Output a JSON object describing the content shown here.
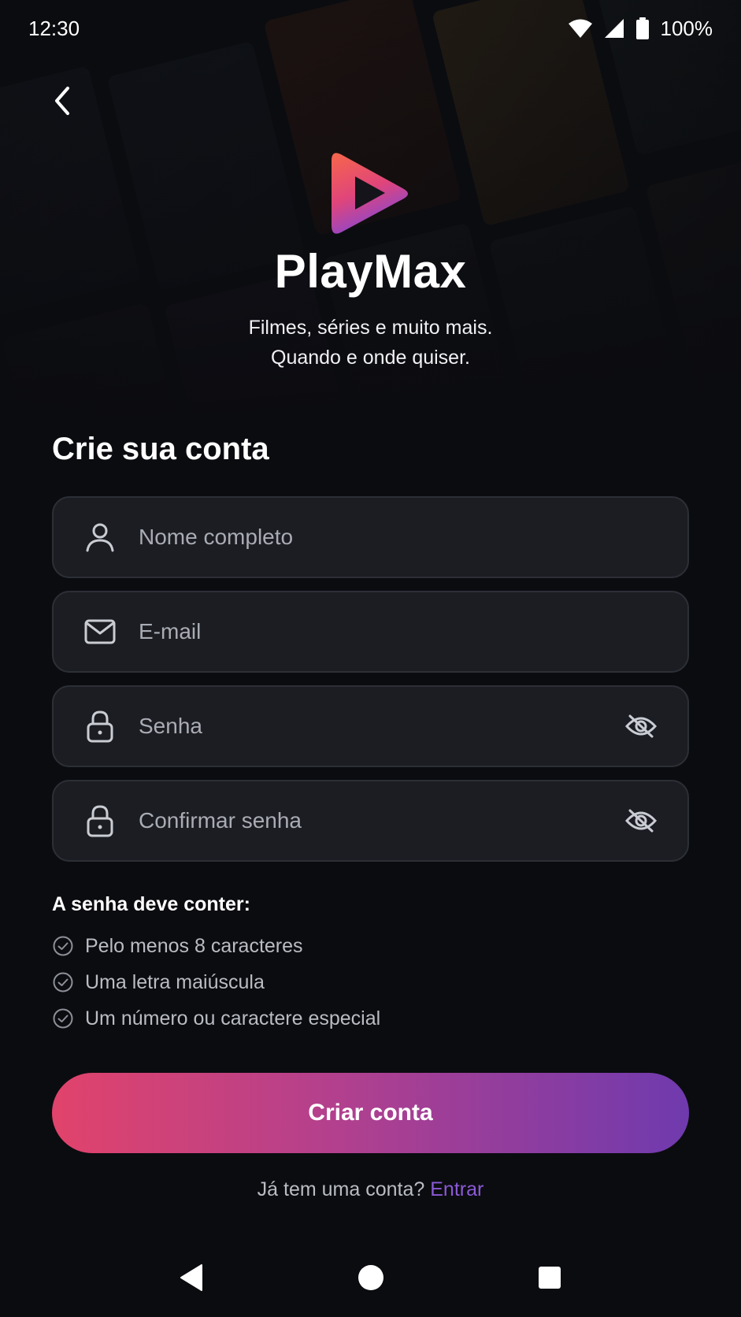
{
  "status_bar": {
    "time": "12:30",
    "battery": "100%"
  },
  "brand": {
    "name": "PlayMax",
    "tagline_line1": "Filmes, séries e muito mais.",
    "tagline_line2": "Quando e onde quiser."
  },
  "form": {
    "title": "Crie sua conta",
    "fields": [
      {
        "placeholder": "Nome completo",
        "icon": "user-icon"
      },
      {
        "placeholder": "E-mail",
        "icon": "mail-icon"
      },
      {
        "placeholder": "Senha",
        "icon": "lock-icon",
        "toggle_icon": "eye-off-icon"
      },
      {
        "placeholder": "Confirmar senha",
        "icon": "lock-icon",
        "toggle_icon": "eye-off-icon"
      }
    ],
    "requirements_title": "A senha deve conter:",
    "requirements": [
      "Pelo menos 8 caracteres",
      "Uma letra maiúscula",
      "Um número ou caractere especial"
    ],
    "submit_label": "Criar conta",
    "signin_prompt": "Já tem uma conta?",
    "signin_link": "Entrar"
  },
  "colors": {
    "background": "#0b0c10",
    "field_bg": "#1b1d22",
    "accent_link": "#8b5ad6",
    "button_gradient_start": "#e1436b",
    "button_gradient_end": "#6f3aae"
  },
  "navigation_bar": [
    "back-triangle-icon",
    "home-circle-icon",
    "recents-square-icon"
  ]
}
